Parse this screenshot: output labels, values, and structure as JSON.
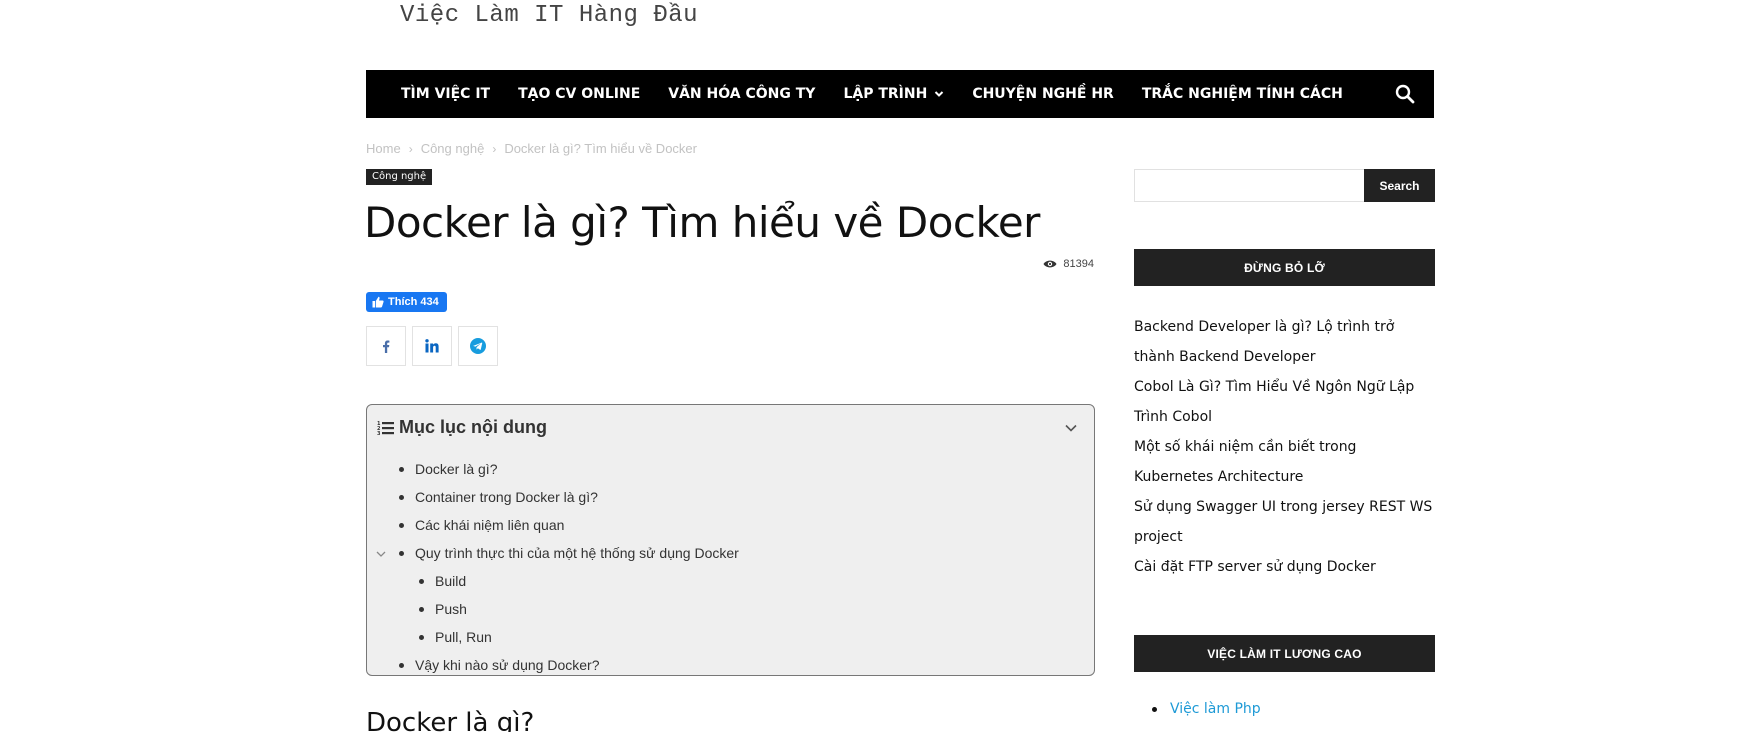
{
  "site": {
    "logo_text": "Việc Làm IT Hàng Đầu"
  },
  "nav": {
    "items": [
      {
        "label": "TÌM VIỆC IT"
      },
      {
        "label": "TẠO CV ONLINE"
      },
      {
        "label": "VĂN HÓA CÔNG TY"
      },
      {
        "label": "LẬP TRÌNH",
        "has_dropdown": true
      },
      {
        "label": "CHUYỆN NGHỀ HR"
      },
      {
        "label": "TRẮC NGHIỆM TÍNH CÁCH"
      }
    ],
    "search_icon": "search-icon"
  },
  "breadcrumb": {
    "items": [
      "Home",
      "Công nghệ",
      "Docker là gì? Tìm hiểu về Docker"
    ],
    "separator": "›"
  },
  "post": {
    "category": "Công nghệ",
    "title": "Docker là gì? Tìm hiểu về Docker",
    "views": "81394",
    "fb_like_label": "Thích 434",
    "share_icons": [
      "facebook-icon",
      "linkedin-icon",
      "telegram-icon"
    ]
  },
  "toc": {
    "title": "Mục lục nội dung",
    "items": [
      {
        "label": "Docker là gì?",
        "level": 1
      },
      {
        "label": "Container trong Docker là gì?",
        "level": 1
      },
      {
        "label": "Các khái niệm liên quan",
        "level": 1
      },
      {
        "label": "Quy trình thực thi của một hệ thống sử dụng Docker",
        "level": 1,
        "expandable": true
      },
      {
        "label": "Build",
        "level": 2
      },
      {
        "label": "Push",
        "level": 2
      },
      {
        "label": "Pull, Run",
        "level": 2
      },
      {
        "label": "Vậy khi nào sử dụng Docker?",
        "level": 1
      }
    ]
  },
  "content": {
    "first_heading": "Docker là gì?"
  },
  "sidebar": {
    "search": {
      "button_label": "Search",
      "placeholder": ""
    },
    "widget_dont_miss": {
      "title": "ĐỪNG BỎ LỠ",
      "posts": [
        "Backend Developer là gì? Lộ trình trở thành Backend Developer",
        "Cobol Là Gì? Tìm Hiểu Về Ngôn Ngữ Lập Trình Cobol",
        "Một số khái niệm cần biết trong Kubernetes Architecture",
        "Sử dụng Swagger UI trong jersey REST WS project",
        "Cài đặt FTP server sử dụng Docker"
      ]
    },
    "widget_jobs": {
      "title": "VIỆC LÀM IT LƯƠNG CAO",
      "items": [
        "Việc làm Php"
      ]
    }
  },
  "colors": {
    "nav_bg": "#000000",
    "widget_bg": "#222222",
    "fb_blue": "#1877f2",
    "link_blue": "#1e9ad6"
  }
}
